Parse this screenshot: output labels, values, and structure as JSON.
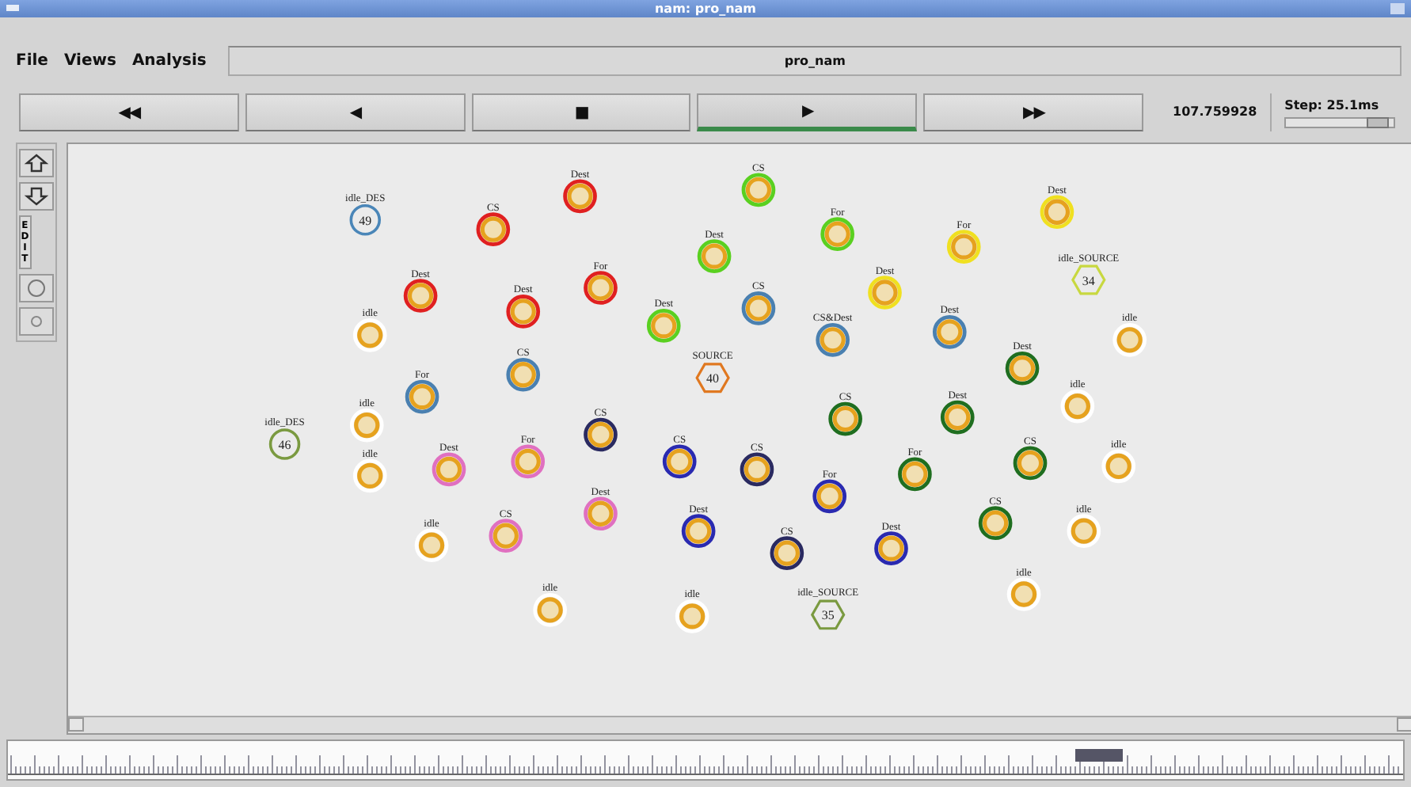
{
  "window": {
    "title": "nam: pro_nam"
  },
  "menu": [
    {
      "label": "File"
    },
    {
      "label": "Views"
    },
    {
      "label": "Analysis"
    }
  ],
  "trace_name": "pro_nam",
  "controls": [
    {
      "symbol": "◀◀",
      "selected": false
    },
    {
      "symbol": "◀",
      "selected": false
    },
    {
      "symbol": "■",
      "selected": false
    },
    {
      "symbol": "▶",
      "selected": true
    },
    {
      "symbol": "▶▶",
      "selected": false
    }
  ],
  "time": "107.759928",
  "step": {
    "label": "Step: 25.1ms",
    "level": 0.85
  },
  "tools": [
    {
      "kind": "zoom-in"
    },
    {
      "kind": "zoom-out"
    },
    {
      "kind": "edit",
      "label": "EDIT"
    },
    {
      "kind": "circle"
    },
    {
      "kind": "small-circle"
    }
  ],
  "nodes": [
    {
      "label": "idle_DES",
      "number": "49",
      "kind": "circle",
      "color": "#4a86b8"
    },
    {
      "label": "CS",
      "kind": "ring",
      "color": "#e02020"
    },
    {
      "label": "Dest",
      "kind": "ring",
      "color": "#e02020"
    },
    {
      "label": "CS",
      "kind": "ring",
      "color": "#5ad020"
    },
    {
      "label": "For",
      "kind": "ring",
      "color": "#5ad020"
    },
    {
      "label": "Dest",
      "kind": "ring",
      "color": "#f0e020"
    },
    {
      "label": "Dest",
      "kind": "ring",
      "color": "#5ad020"
    },
    {
      "label": "For",
      "kind": "ring",
      "color": "#f0e020"
    },
    {
      "label": "Dest",
      "kind": "ring",
      "color": "#e02020"
    },
    {
      "label": "For",
      "kind": "ring",
      "color": "#e02020"
    },
    {
      "label": "Dest",
      "kind": "ring",
      "color": "#f0e020"
    },
    {
      "label": "idle_SOURCE",
      "number": "34",
      "kind": "hexagon",
      "color": "#c8d840"
    },
    {
      "label": "idle",
      "kind": "ring",
      "color": "#ffffff"
    },
    {
      "label": "Dest",
      "kind": "ring",
      "color": "#e02020"
    },
    {
      "label": "Dest",
      "kind": "ring",
      "color": "#5ad020"
    },
    {
      "label": "CS",
      "kind": "ring",
      "color": "#4a80b0"
    },
    {
      "label": "CS&Dest",
      "kind": "ring",
      "color": "#4a80b0"
    },
    {
      "label": "Dest",
      "kind": "ring",
      "color": "#4a80b0"
    },
    {
      "label": "idle",
      "kind": "ring",
      "color": "#ffffff"
    },
    {
      "label": "For",
      "kind": "ring",
      "color": "#4a80b0"
    },
    {
      "label": "CS",
      "kind": "ring",
      "color": "#4a80b0"
    },
    {
      "label": "SOURCE",
      "number": "40",
      "kind": "hexagon",
      "color": "#e07820"
    },
    {
      "label": "Dest",
      "kind": "ring",
      "color": "#1f6e1f"
    },
    {
      "label": "idle",
      "kind": "ring",
      "color": "#ffffff"
    },
    {
      "label": "idle_DES",
      "number": "46",
      "kind": "circle",
      "color": "#7a9a40"
    },
    {
      "label": "idle",
      "kind": "ring",
      "color": "#ffffff"
    },
    {
      "label": "CS",
      "kind": "ring",
      "color": "#2a2a60"
    },
    {
      "label": "CS",
      "kind": "ring",
      "color": "#1f6e1f"
    },
    {
      "label": "Dest",
      "kind": "ring",
      "color": "#1f6e1f"
    },
    {
      "label": "idle",
      "kind": "ring",
      "color": "#ffffff"
    },
    {
      "label": "Dest",
      "kind": "ring",
      "color": "#e070c0"
    },
    {
      "label": "For",
      "kind": "ring",
      "color": "#e070c0"
    },
    {
      "label": "CS",
      "kind": "ring",
      "color": "#2a2ab0"
    },
    {
      "label": "CS",
      "kind": "ring",
      "color": "#2a2a60"
    },
    {
      "label": "For",
      "kind": "ring",
      "color": "#1f6e1f"
    },
    {
      "label": "CS",
      "kind": "ring",
      "color": "#1f6e1f"
    },
    {
      "label": "idle",
      "kind": "ring",
      "color": "#ffffff"
    },
    {
      "label": "idle",
      "kind": "ring",
      "color": "#ffffff"
    },
    {
      "label": "CS",
      "kind": "ring",
      "color": "#e070c0"
    },
    {
      "label": "Dest",
      "kind": "ring",
      "color": "#e070c0"
    },
    {
      "label": "Dest",
      "kind": "ring",
      "color": "#2a2ab0"
    },
    {
      "label": "CS",
      "kind": "ring",
      "color": "#2a2a60"
    },
    {
      "label": "For",
      "kind": "ring",
      "color": "#2a2ab0"
    },
    {
      "label": "Dest",
      "kind": "ring",
      "color": "#2a2ab0"
    },
    {
      "label": "CS",
      "kind": "ring",
      "color": "#1f6e1f"
    },
    {
      "label": "idle",
      "kind": "ring",
      "color": "#ffffff"
    },
    {
      "label": "idle",
      "kind": "ring",
      "color": "#ffffff"
    },
    {
      "label": "idle",
      "kind": "ring",
      "color": "#ffffff"
    },
    {
      "label": "idle_SOURCE",
      "number": "35",
      "kind": "hexagon",
      "color": "#7a9a40"
    },
    {
      "label": "idle",
      "kind": "ring",
      "color": "#ffffff"
    }
  ]
}
